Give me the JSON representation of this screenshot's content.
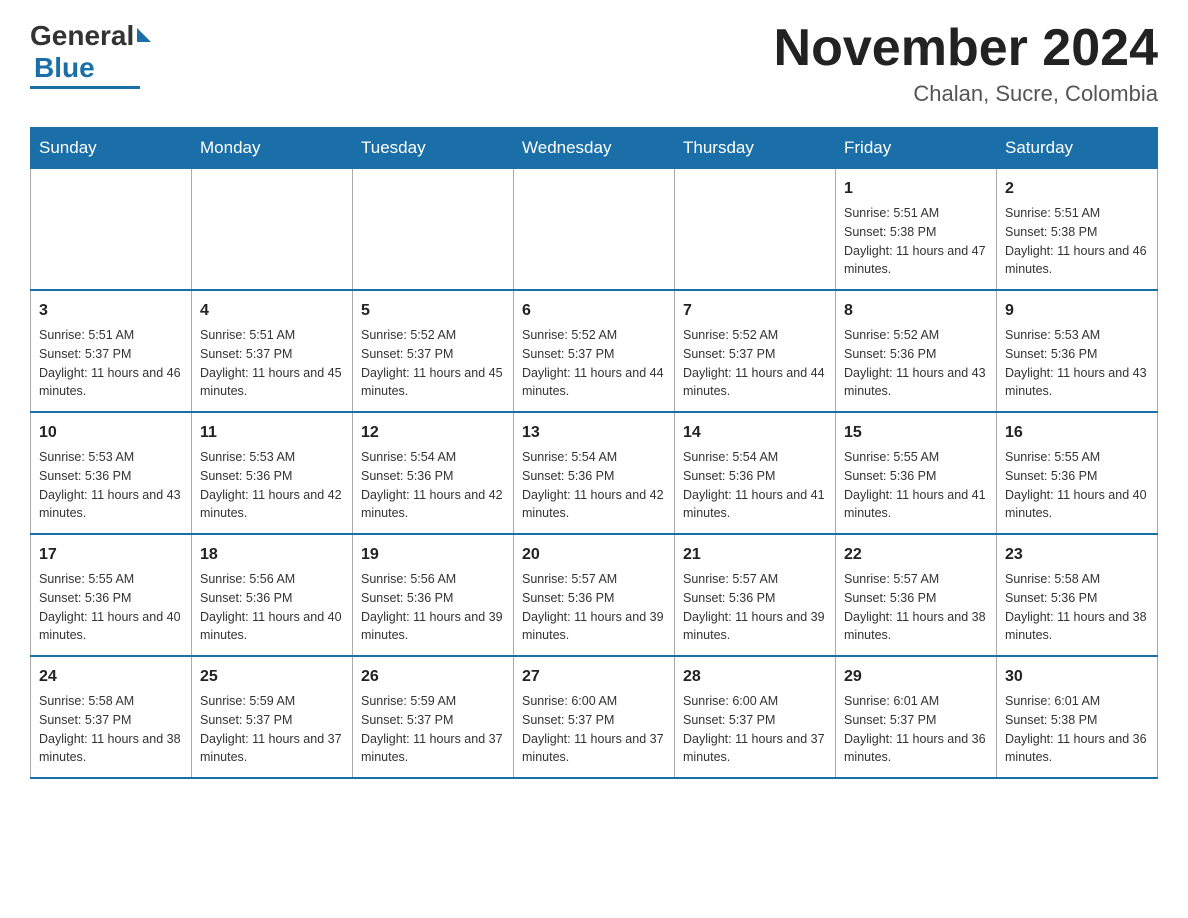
{
  "header": {
    "logo_general": "General",
    "logo_blue": "Blue",
    "month_year": "November 2024",
    "location": "Chalan, Sucre, Colombia"
  },
  "weekdays": [
    "Sunday",
    "Monday",
    "Tuesday",
    "Wednesday",
    "Thursday",
    "Friday",
    "Saturday"
  ],
  "weeks": [
    [
      {
        "day": "",
        "info": ""
      },
      {
        "day": "",
        "info": ""
      },
      {
        "day": "",
        "info": ""
      },
      {
        "day": "",
        "info": ""
      },
      {
        "day": "",
        "info": ""
      },
      {
        "day": "1",
        "info": "Sunrise: 5:51 AM\nSunset: 5:38 PM\nDaylight: 11 hours and 47 minutes."
      },
      {
        "day": "2",
        "info": "Sunrise: 5:51 AM\nSunset: 5:38 PM\nDaylight: 11 hours and 46 minutes."
      }
    ],
    [
      {
        "day": "3",
        "info": "Sunrise: 5:51 AM\nSunset: 5:37 PM\nDaylight: 11 hours and 46 minutes."
      },
      {
        "day": "4",
        "info": "Sunrise: 5:51 AM\nSunset: 5:37 PM\nDaylight: 11 hours and 45 minutes."
      },
      {
        "day": "5",
        "info": "Sunrise: 5:52 AM\nSunset: 5:37 PM\nDaylight: 11 hours and 45 minutes."
      },
      {
        "day": "6",
        "info": "Sunrise: 5:52 AM\nSunset: 5:37 PM\nDaylight: 11 hours and 44 minutes."
      },
      {
        "day": "7",
        "info": "Sunrise: 5:52 AM\nSunset: 5:37 PM\nDaylight: 11 hours and 44 minutes."
      },
      {
        "day": "8",
        "info": "Sunrise: 5:52 AM\nSunset: 5:36 PM\nDaylight: 11 hours and 43 minutes."
      },
      {
        "day": "9",
        "info": "Sunrise: 5:53 AM\nSunset: 5:36 PM\nDaylight: 11 hours and 43 minutes."
      }
    ],
    [
      {
        "day": "10",
        "info": "Sunrise: 5:53 AM\nSunset: 5:36 PM\nDaylight: 11 hours and 43 minutes."
      },
      {
        "day": "11",
        "info": "Sunrise: 5:53 AM\nSunset: 5:36 PM\nDaylight: 11 hours and 42 minutes."
      },
      {
        "day": "12",
        "info": "Sunrise: 5:54 AM\nSunset: 5:36 PM\nDaylight: 11 hours and 42 minutes."
      },
      {
        "day": "13",
        "info": "Sunrise: 5:54 AM\nSunset: 5:36 PM\nDaylight: 11 hours and 42 minutes."
      },
      {
        "day": "14",
        "info": "Sunrise: 5:54 AM\nSunset: 5:36 PM\nDaylight: 11 hours and 41 minutes."
      },
      {
        "day": "15",
        "info": "Sunrise: 5:55 AM\nSunset: 5:36 PM\nDaylight: 11 hours and 41 minutes."
      },
      {
        "day": "16",
        "info": "Sunrise: 5:55 AM\nSunset: 5:36 PM\nDaylight: 11 hours and 40 minutes."
      }
    ],
    [
      {
        "day": "17",
        "info": "Sunrise: 5:55 AM\nSunset: 5:36 PM\nDaylight: 11 hours and 40 minutes."
      },
      {
        "day": "18",
        "info": "Sunrise: 5:56 AM\nSunset: 5:36 PM\nDaylight: 11 hours and 40 minutes."
      },
      {
        "day": "19",
        "info": "Sunrise: 5:56 AM\nSunset: 5:36 PM\nDaylight: 11 hours and 39 minutes."
      },
      {
        "day": "20",
        "info": "Sunrise: 5:57 AM\nSunset: 5:36 PM\nDaylight: 11 hours and 39 minutes."
      },
      {
        "day": "21",
        "info": "Sunrise: 5:57 AM\nSunset: 5:36 PM\nDaylight: 11 hours and 39 minutes."
      },
      {
        "day": "22",
        "info": "Sunrise: 5:57 AM\nSunset: 5:36 PM\nDaylight: 11 hours and 38 minutes."
      },
      {
        "day": "23",
        "info": "Sunrise: 5:58 AM\nSunset: 5:36 PM\nDaylight: 11 hours and 38 minutes."
      }
    ],
    [
      {
        "day": "24",
        "info": "Sunrise: 5:58 AM\nSunset: 5:37 PM\nDaylight: 11 hours and 38 minutes."
      },
      {
        "day": "25",
        "info": "Sunrise: 5:59 AM\nSunset: 5:37 PM\nDaylight: 11 hours and 37 minutes."
      },
      {
        "day": "26",
        "info": "Sunrise: 5:59 AM\nSunset: 5:37 PM\nDaylight: 11 hours and 37 minutes."
      },
      {
        "day": "27",
        "info": "Sunrise: 6:00 AM\nSunset: 5:37 PM\nDaylight: 11 hours and 37 minutes."
      },
      {
        "day": "28",
        "info": "Sunrise: 6:00 AM\nSunset: 5:37 PM\nDaylight: 11 hours and 37 minutes."
      },
      {
        "day": "29",
        "info": "Sunrise: 6:01 AM\nSunset: 5:37 PM\nDaylight: 11 hours and 36 minutes."
      },
      {
        "day": "30",
        "info": "Sunrise: 6:01 AM\nSunset: 5:38 PM\nDaylight: 11 hours and 36 minutes."
      }
    ]
  ]
}
